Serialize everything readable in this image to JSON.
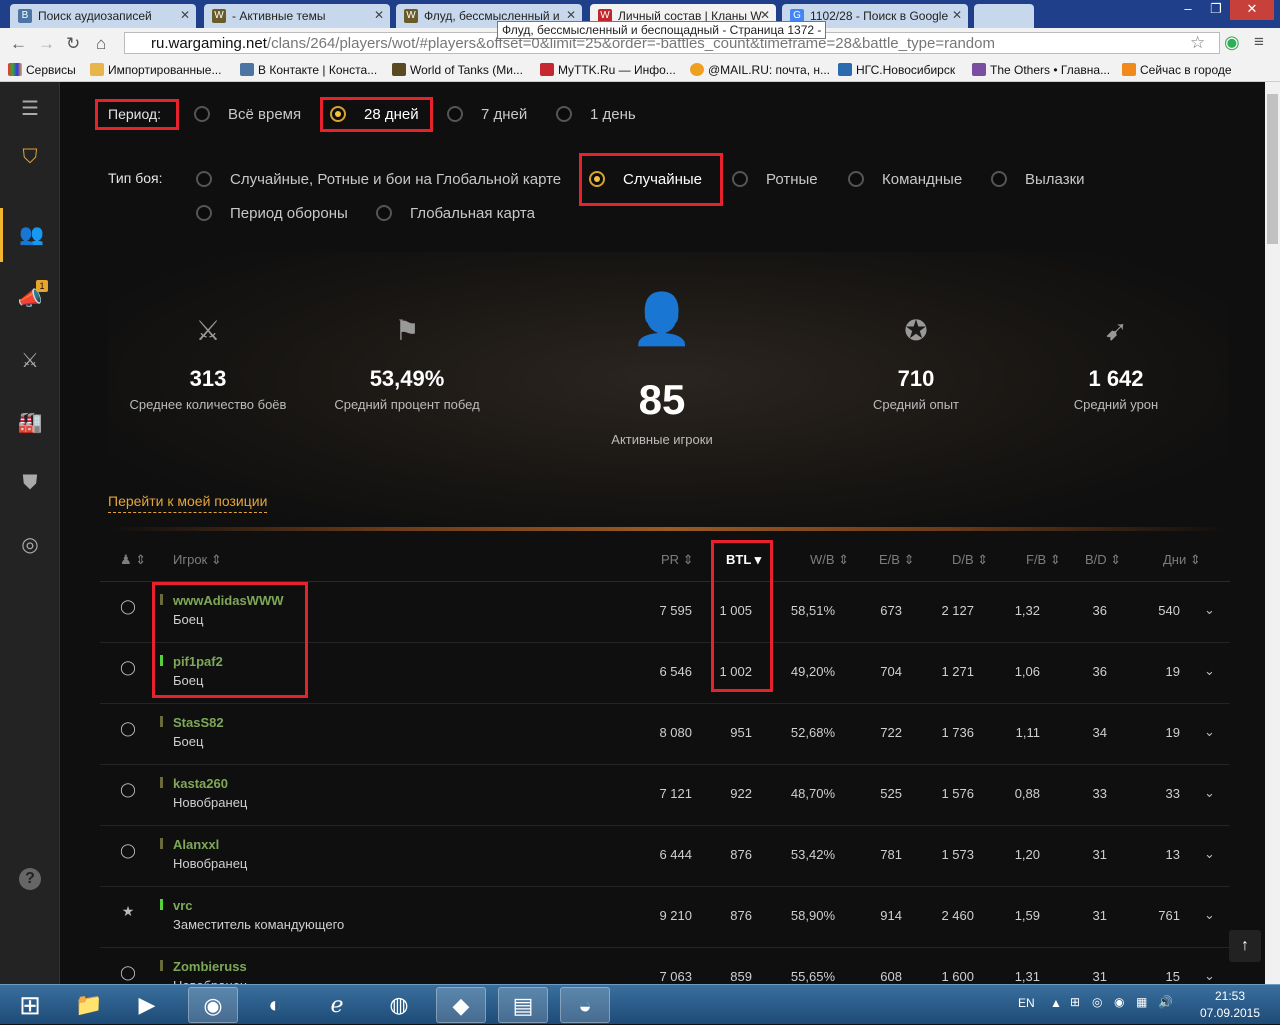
{
  "browser": {
    "tabs": [
      {
        "title": "Поиск аудиозаписей",
        "icon": "vk",
        "active": false
      },
      {
        "title": "- Активные темы",
        "icon": "wot",
        "active": false
      },
      {
        "title": "Флуд, бессмысленный и",
        "icon": "wot",
        "active": false
      },
      {
        "title": "Личный состав | Кланы W",
        "icon": "wargaming",
        "active": true
      },
      {
        "title": "1102/28 - Поиск в Google",
        "icon": "google",
        "active": false
      }
    ],
    "tooltip": "Флуд, бессмысленный и беспощадный - Страница 1372 -",
    "url_host": "ru.wargaming.net",
    "url_path": "/clans/264/players/wot/#players&offset=0&limit=25&order=-battles_count&timeframe=28&battle_type=random",
    "bookmarks": [
      "Сервисы",
      "Импортированные...",
      "В Контакте | Конста...",
      "World of Tanks (Ми...",
      "MyTTK.Ru — Инфо...",
      "@MAIL.RU: почта, н...",
      "НГС.Новосибирск",
      "The Others • Главна...",
      "Сейчас в городе"
    ]
  },
  "sidebar": {
    "badge": "1",
    "help": "?"
  },
  "filters": {
    "period_label": "Период:",
    "period_options": [
      "Всё время",
      "28 дней",
      "7 дней",
      "1 день"
    ],
    "period_selected": "28 дней",
    "battle_label": "Тип боя:",
    "battle_options": [
      "Случайные, Ротные и бои на Глобальной карте",
      "Случайные",
      "Ротные",
      "Командные",
      "Вылазки",
      "Период обороны",
      "Глобальная карта"
    ],
    "battle_selected": "Случайные"
  },
  "stats": {
    "avg_battles": {
      "value": "313",
      "label": "Среднее количество боёв"
    },
    "avg_winrate": {
      "value": "53,49%",
      "label": "Средний процент побед"
    },
    "active_players": {
      "value": "85",
      "label": "Активные игроки"
    },
    "avg_exp": {
      "value": "710",
      "label": "Средний опыт"
    },
    "avg_damage": {
      "value": "1 642",
      "label": "Средний урон"
    }
  },
  "my_position": "Перейти к моей позиции",
  "table": {
    "headers": {
      "player": "Игрок",
      "pr": "PR",
      "btl": "BTL",
      "wb": "W/B",
      "eb": "E/B",
      "db": "D/B",
      "fb": "F/B",
      "bd": "B/D",
      "days": "Дни"
    },
    "rows": [
      {
        "name": "wwwAdidasWWW",
        "role": "Боец",
        "online": false,
        "pr": "7 595",
        "btl": "1 005",
        "wb": "58,51%",
        "eb": "673",
        "db": "2 127",
        "fb": "1,32",
        "bd": "36",
        "days": "540"
      },
      {
        "name": "pif1paf2",
        "role": "Боец",
        "online": true,
        "pr": "6 546",
        "btl": "1 002",
        "wb": "49,20%",
        "eb": "704",
        "db": "1 271",
        "fb": "1,06",
        "bd": "36",
        "days": "19"
      },
      {
        "name": "StasS82",
        "role": "Боец",
        "online": false,
        "pr": "8 080",
        "btl": "951",
        "wb": "52,68%",
        "eb": "722",
        "db": "1 736",
        "fb": "1,11",
        "bd": "34",
        "days": "19"
      },
      {
        "name": "kasta260",
        "role": "Новобранец",
        "online": false,
        "pr": "7 121",
        "btl": "922",
        "wb": "48,70%",
        "eb": "525",
        "db": "1 576",
        "fb": "0,88",
        "bd": "33",
        "days": "33"
      },
      {
        "name": "Alanxxl",
        "role": "Новобранец",
        "online": false,
        "pr": "6 444",
        "btl": "876",
        "wb": "53,42%",
        "eb": "781",
        "db": "1 573",
        "fb": "1,20",
        "bd": "31",
        "days": "13"
      },
      {
        "name": "vrc",
        "role": "Заместитель командующего",
        "online": true,
        "pr": "9 210",
        "btl": "876",
        "wb": "58,90%",
        "eb": "914",
        "db": "2 460",
        "fb": "1,59",
        "bd": "31",
        "days": "761"
      },
      {
        "name": "Zombieruss",
        "role": "Новобранец",
        "online": false,
        "pr": "7 063",
        "btl": "859",
        "wb": "55,65%",
        "eb": "608",
        "db": "1 600",
        "fb": "1,31",
        "bd": "31",
        "days": "15"
      }
    ]
  },
  "taskbar": {
    "lang": "EN",
    "time": "21:53",
    "date": "07.09.2015"
  },
  "colors": {
    "accent": "#f2c23a",
    "highlight": "#e8222c",
    "player_name": "#7ea857"
  }
}
